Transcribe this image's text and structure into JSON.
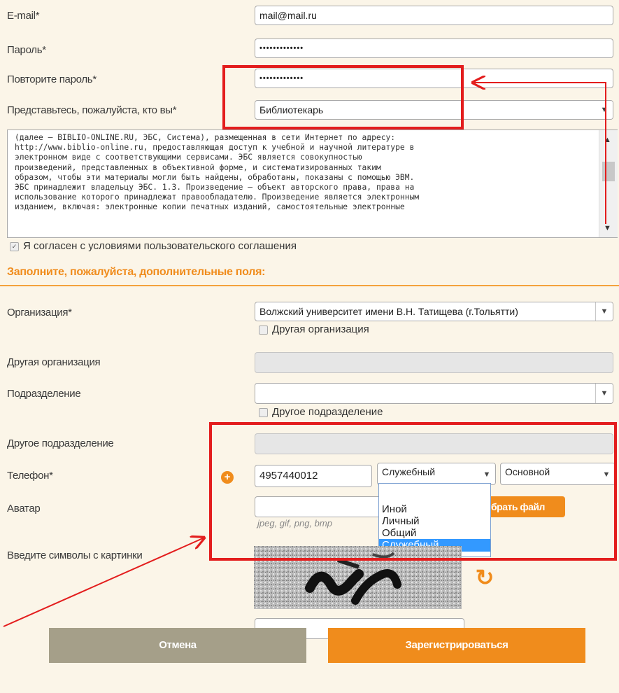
{
  "form": {
    "email_label": "E-mail*",
    "email_value": "mail@mail.ru",
    "password_label": "Пароль*",
    "password_value": "•••••••••••••",
    "repeat_password_label": "Повторите пароль*",
    "repeat_password_value": "•••••••••••••",
    "role_label": "Представьтесь, пожалуйста, кто вы*",
    "role_value": "Библиотекарь",
    "terms_lines": [
      "(далее – BIBLIO-ONLINE.RU, ЭБС, Система), размещенная в сети Интернет по адресу:",
      "http://www.biblio-online.ru, предоставляющая доступ к учебной и научной литературе в",
      "электронном виде с соответствующими сервисами. ЭБС является совокупностью",
      "произведений, представленных в объективной форме, и систематизированных таким",
      "образом, чтобы эти материалы могли быть найдены, обработаны, показаны с помощью ЭВМ.",
      "ЭБС принадлежит владельцу ЭБС. 1.3. Произведение – объект авторского права, права на",
      "использование которого принадлежат правообладателю. Произведение является электронным",
      "изданием, включая: электронные копии печатных изданий, самостоятельные электронные"
    ],
    "agree_label": "Я согласен с условиями пользовательского соглашения"
  },
  "extra": {
    "section_title": "Заполните, пожалуйста, дополнительные поля:",
    "organization_label": "Организация*",
    "organization_value": "Волжский университет имени В.Н. Татищева (г.Тольятти)",
    "other_org_checkbox": "Другая организация",
    "other_org_label": "Другая организация",
    "subdivision_label": "Подразделение",
    "subdivision_value": "",
    "other_subdiv_checkbox": "Другое подразделение",
    "other_subdiv_label": "Другое подразделение",
    "phone_label": "Телефон*",
    "phone_value": "4957440012",
    "phone_type_value": "Служебный",
    "phone_priority_value": "Основной",
    "phone_type_options": [
      "Иной",
      "Личный",
      "Общий",
      "Служебный"
    ],
    "avatar_label": "Аватар",
    "avatar_button": "брать файл",
    "avatar_hint": "jpeg, gif, png, bmp",
    "captcha_label": "Введите символы с картинки",
    "captcha_value": ""
  },
  "buttons": {
    "cancel": "Отмена",
    "register": "Зарегистрироваться"
  },
  "icons": {
    "dropdown": "▼",
    "checkbox_checked": "✓",
    "plus": "+",
    "refresh": "↻",
    "scroll_up": "▲",
    "scroll_down": "▼"
  },
  "colors": {
    "accent": "#f08c1c",
    "annotation": "#e31d1d"
  }
}
